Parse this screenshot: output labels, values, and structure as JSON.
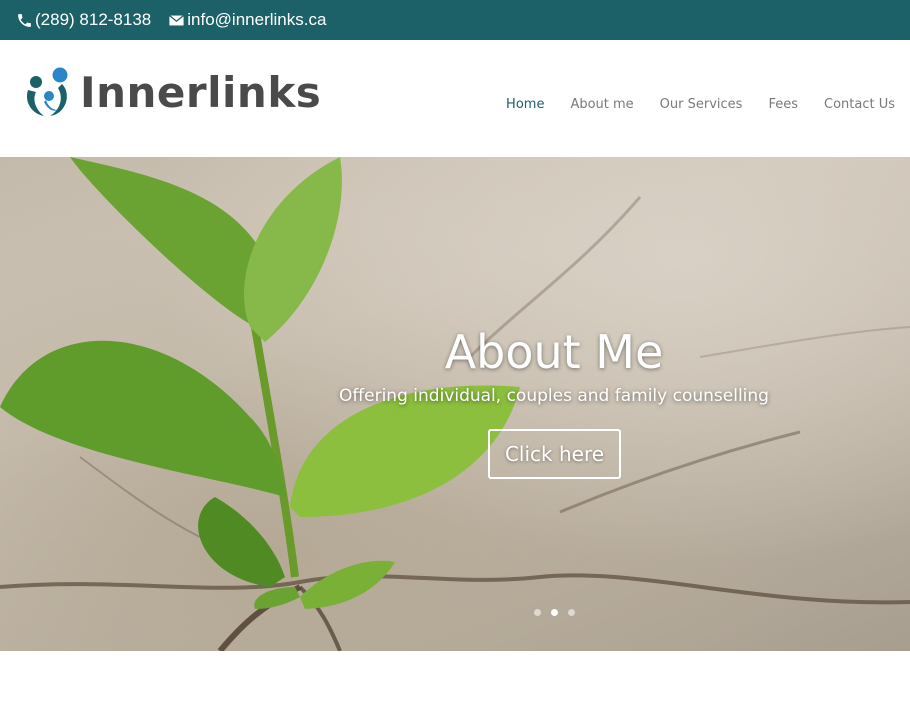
{
  "topbar": {
    "phone": "(289) 812-8138",
    "email": "info@innerlinks.ca",
    "phone_icon": "phone-icon",
    "email_icon": "envelope-icon",
    "background": "#1c6167"
  },
  "header": {
    "logo_text": "Innerlinks",
    "nav": [
      {
        "label": "Home",
        "active": true
      },
      {
        "label": "About me",
        "active": false
      },
      {
        "label": "Our Services",
        "active": false
      },
      {
        "label": "Fees",
        "active": false
      },
      {
        "label": "Contact Us",
        "active": false
      }
    ],
    "accent": "#1c6167"
  },
  "hero": {
    "title": "About Me",
    "subtitle": "Offering individual, couples and family counselling",
    "button_label": "Click here",
    "slides": 3,
    "active_slide": 2
  }
}
